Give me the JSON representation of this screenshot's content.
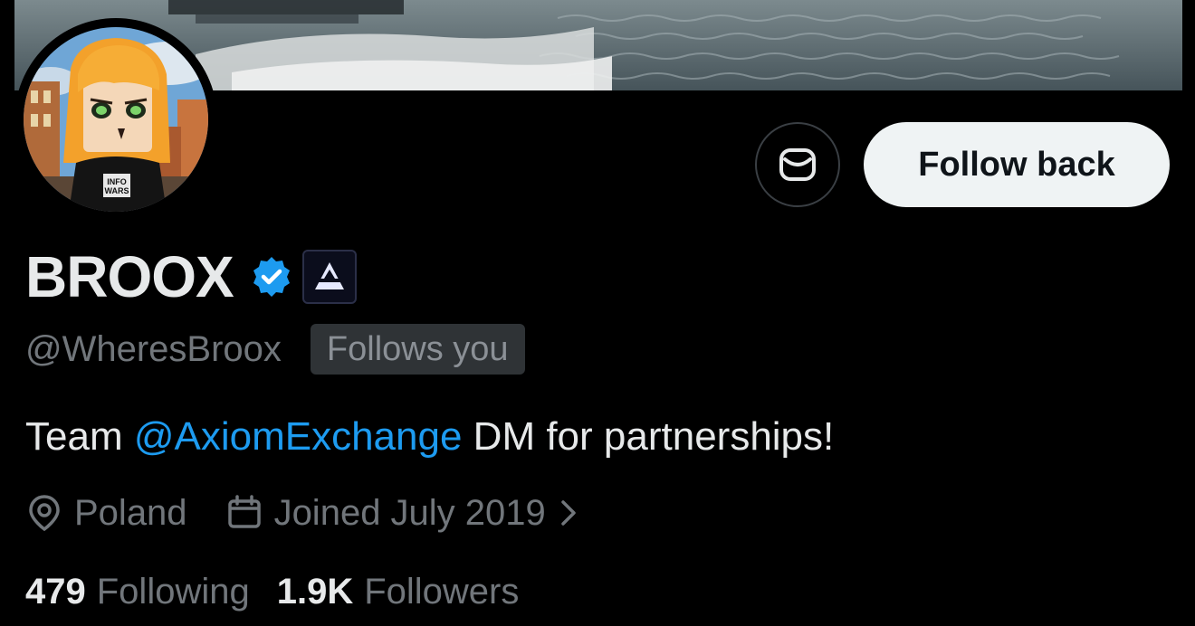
{
  "profile": {
    "display_name": "BROOX",
    "handle": "@WheresBroox",
    "follows_you_label": "Follows you",
    "bio": {
      "prefix": "Team ",
      "mention": "@AxiomExchange",
      "suffix": " DM for partnerships!"
    },
    "location": "Poland",
    "joined": "Joined July 2019"
  },
  "stats": {
    "following_count": "479",
    "following_label": "Following",
    "followers_count": "1.9K",
    "followers_label": "Followers"
  },
  "actions": {
    "follow_back_label": "Follow back"
  },
  "avatar": {
    "shirt_text": "INFO WARS"
  },
  "icons": {
    "message": "envelope-icon",
    "verified": "verified-badge-icon",
    "affiliate": "axiom-affiliate-icon",
    "location": "location-pin-icon",
    "calendar": "calendar-icon",
    "chevron": "chevron-right-icon"
  },
  "colors": {
    "background": "#000000",
    "accent": "#1d9bf0",
    "text_primary": "#e7e9ea",
    "text_secondary": "#71767b",
    "follow_button_bg": "#eff3f4"
  }
}
